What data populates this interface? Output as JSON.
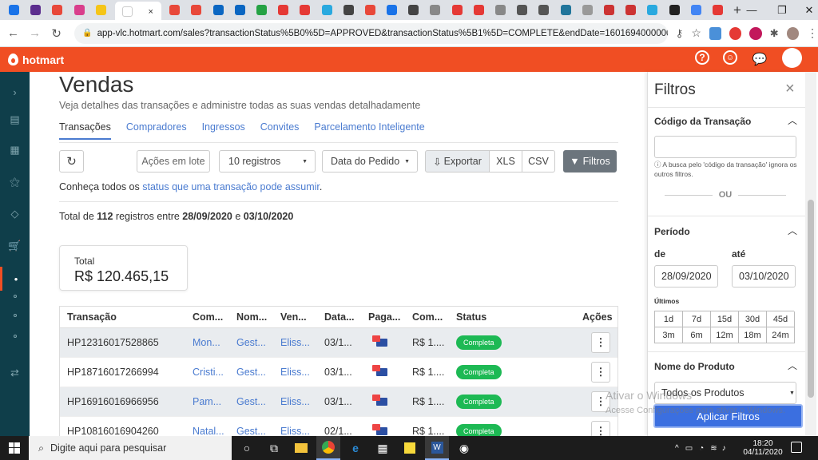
{
  "browser": {
    "url": "app-vlc.hotmart.com/sales?transactionStatus%5B0%5D=APPROVED&transactionStatus%5B1%5D=COMPLETE&endDate=1601694000000&startDate=1...",
    "tab_close": "×",
    "new_tab": "+",
    "favicon_colors": [
      "#1a73e8",
      "#5b2d8e",
      "#e8483a",
      "#d93e8c",
      "#f5c518",
      "#ffffff",
      "#e8483a",
      "#e8483a",
      "#0a66c2",
      "#0a66c2",
      "#25a244",
      "#e53935",
      "#e53935",
      "#29a9df",
      "#444",
      "#e8483a",
      "#1a73e8",
      "#444",
      "#888",
      "#e53935",
      "#e53935",
      "#888",
      "#555",
      "#555",
      "#21759b",
      "#999",
      "#c33",
      "#c33",
      "#29a9df",
      "#222",
      "#4285f4",
      "#e53935"
    ]
  },
  "hotmart": {
    "logo": "hotmart",
    "help_icon": "?",
    "brand_color": "#f04e23"
  },
  "page": {
    "title": "Vendas",
    "subtitle": "Veja detalhes das transações e administre todas as suas vendas detalhadamente",
    "tabs": [
      "Transações",
      "Compradores",
      "Ingressos",
      "Convites",
      "Parcelamento Inteligente"
    ],
    "toolbar": {
      "refresh_icon": "↻",
      "batch_actions": "Ações em lote",
      "page_size": "10 registros",
      "date_field": "Data do Pedido",
      "export": "Exportar",
      "xls": "XLS",
      "csv": "CSV",
      "filters": "Filtros"
    },
    "info_text": "Conheça todos os ",
    "info_link": "status que uma transação pode assumir",
    "info_end": ".",
    "total_prefix": "Total de ",
    "total_count": "112",
    "total_mid": " registros entre ",
    "start_date": "28/09/2020",
    "total_and": " e ",
    "end_date": "03/10/2020",
    "total_card": {
      "label": "Total",
      "value": "R$ 120.465,15"
    }
  },
  "table": {
    "headers": [
      "Transação",
      "Com...",
      "Nom...",
      "Ven...",
      "Data...",
      "Paga...",
      "Com...",
      "Status",
      "Ações"
    ],
    "rows": [
      {
        "id": "HP12316017528865",
        "buyer": "Mon...",
        "product": "Gest...",
        "seller": "Eliss...",
        "date": "03/1...",
        "payment": "card",
        "commission": "R$ 1....",
        "status": "Completa"
      },
      {
        "id": "HP18716017266994",
        "buyer": "Cristi...",
        "product": "Gest...",
        "seller": "Eliss...",
        "date": "03/1...",
        "payment": "card",
        "commission": "R$ 1....",
        "status": "Completa"
      },
      {
        "id": "HP16916016966956",
        "buyer": "Pam...",
        "product": "Gest...",
        "seller": "Eliss...",
        "date": "03/1...",
        "payment": "visa",
        "commission": "R$ 1....",
        "status": "Completa"
      },
      {
        "id": "HP10816016904260",
        "buyer": "Natal...",
        "product": "Gest...",
        "seller": "Eliss...",
        "date": "02/1...",
        "payment": "card",
        "commission": "R$ 1....",
        "status": "Completa"
      }
    ],
    "action_label": "⋮"
  },
  "filters": {
    "title": "Filtros",
    "close": "×",
    "transaction_code_label": "Código da Transação",
    "transaction_code_value": "",
    "hint": "ⓘ A busca pelo 'código da transação' ignora os outros filtros.",
    "or": "OU",
    "period_label": "Período",
    "from_label": "de",
    "to_label": "até",
    "from_value": "28/09/2020",
    "to_value": "03/10/2020",
    "last_label": "Últimos",
    "quick_ranges": [
      "1d",
      "7d",
      "15d",
      "30d",
      "45d",
      "3m",
      "6m",
      "12m",
      "18m",
      "24m"
    ],
    "product_label": "Nome do Produto",
    "product_value": "Todos os Produtos",
    "apply": "Aplicar Filtros"
  },
  "watermark": {
    "line1": "Ativar o Windows",
    "line2": "Acesse Configurações para ativar o Windows."
  },
  "taskbar": {
    "search_placeholder": "Digite aqui para pesquisar",
    "time": "18:20",
    "date": "04/11/2020"
  }
}
